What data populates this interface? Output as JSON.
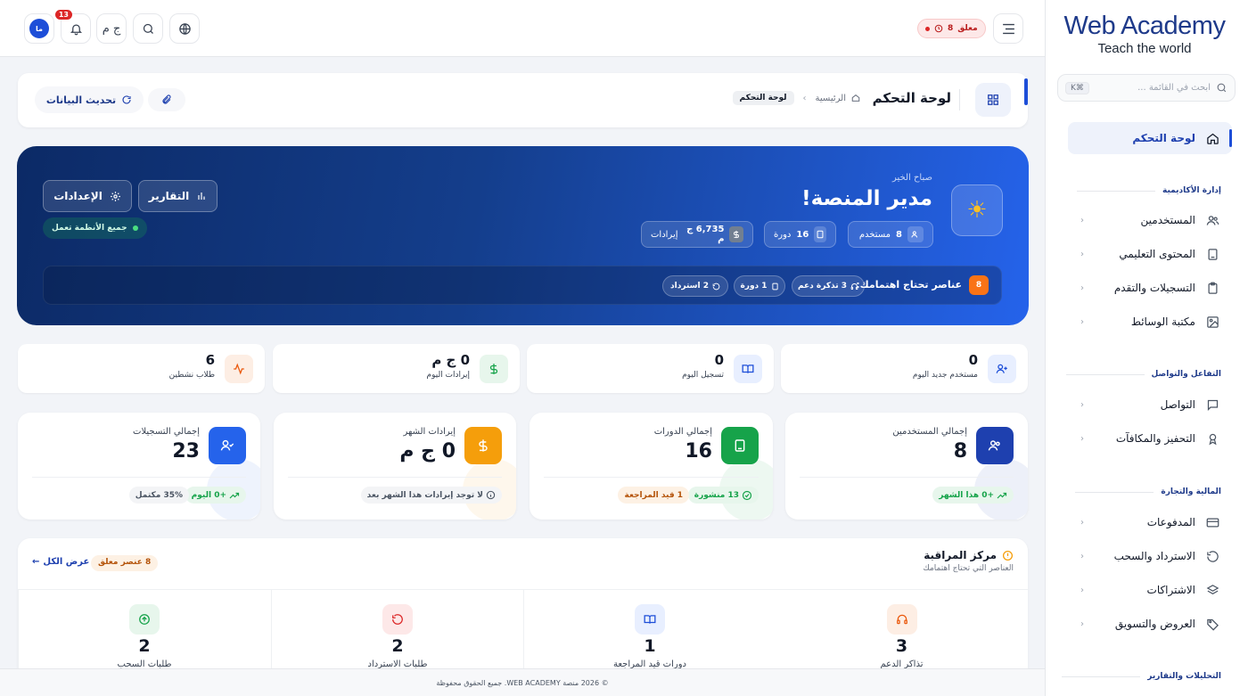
{
  "brand": {
    "name": "Web Academy",
    "tagline": "Teach the world"
  },
  "sidebar": {
    "search_placeholder": "ابحث في القائمة ...",
    "shortcut": "⌘K",
    "active": {
      "label": "لوحة التحكم",
      "icon": "home-icon"
    },
    "sections": [
      {
        "title": "إدارة الأكاديمية",
        "items": [
          {
            "label": "المستخدمين",
            "icon": "users-icon"
          },
          {
            "label": "المحتوى التعليمي",
            "icon": "book-icon"
          },
          {
            "label": "التسجيلات والتقدم",
            "icon": "clipboard-icon"
          },
          {
            "label": "مكتبة الوسائط",
            "icon": "image-icon"
          }
        ]
      },
      {
        "title": "التفاعل والتواصل",
        "items": [
          {
            "label": "التواصل",
            "icon": "chat-icon"
          },
          {
            "label": "التحفيز والمكافآت",
            "icon": "award-icon"
          }
        ]
      },
      {
        "title": "المالية والتجارة",
        "items": [
          {
            "label": "المدفوعات",
            "icon": "card-icon"
          },
          {
            "label": "الاسترداد والسحب",
            "icon": "refund-icon"
          },
          {
            "label": "الاشتراكات",
            "icon": "layers-icon"
          },
          {
            "label": "العروض والتسويق",
            "icon": "tag-icon"
          }
        ]
      },
      {
        "title": "التحليلات والتقارير",
        "items": []
      }
    ]
  },
  "topbar": {
    "avatar_initials": "ما",
    "notifications_count": "13",
    "currency_label": "ج م",
    "pending": {
      "count": "8",
      "label": "معلق"
    }
  },
  "header": {
    "title": "لوحة التحكم",
    "breadcrumb_home": "الرئيسية",
    "breadcrumb_current": "لوحة التحكم",
    "refresh_label": "تحديث البيانات"
  },
  "hero": {
    "greeting": "صباح الخير",
    "name": "مدير المنصة!",
    "chips": [
      {
        "value": "8",
        "label": "مستخدم",
        "icon": "users-icon"
      },
      {
        "value": "16",
        "label": "دورة",
        "icon": "book-icon"
      },
      {
        "value": "6,735 ج م",
        "label": "إيرادات",
        "icon": "dollar-icon"
      }
    ],
    "reports_label": "التقارير",
    "settings_label": "الإعدادات",
    "status_label": "جميع الأنظمة تعمل",
    "attention": {
      "count": "8",
      "label": "عناصر تحتاج اهتمامك:",
      "chips": [
        {
          "text": "3 تذكرة دعم",
          "icon": "headphones-icon"
        },
        {
          "text": "1 دورة",
          "icon": "book-icon"
        },
        {
          "text": "2 استرداد",
          "icon": "refund-icon"
        }
      ]
    }
  },
  "today": [
    {
      "value": "0",
      "label": "مستخدم جديد اليوم",
      "icon": "user-plus-icon",
      "color": "#1d4ed8",
      "bg": "#e8efff"
    },
    {
      "value": "0",
      "label": "تسجيل اليوم",
      "icon": "book-icon",
      "color": "#1d4ed8",
      "bg": "#e8efff"
    },
    {
      "value": "0 ج م",
      "label": "إيرادات اليوم",
      "icon": "dollar-icon",
      "color": "#16a34a",
      "bg": "#e7f6ec"
    },
    {
      "value": "6",
      "label": "طلاب نشطين",
      "icon": "activity-icon",
      "color": "#ea580c",
      "bg": "#fdeee4"
    }
  ],
  "totals": [
    {
      "label": "إجمالي المستخدمين",
      "value": "8",
      "icon": "users-icon",
      "color": "#1e40af",
      "pills": [
        {
          "text": "+0 هذا الشهر",
          "fg": "#16a34a",
          "bg": "#e7f6ec"
        }
      ]
    },
    {
      "label": "إجمالي الدورات",
      "value": "16",
      "icon": "book-icon",
      "color": "#16a34a",
      "pills": [
        {
          "text": "13 منشورة",
          "fg": "#16a34a",
          "bg": "#e7f6ec"
        },
        {
          "text": "1 قيد المراجعة",
          "fg": "#b45309",
          "bg": "#fdf1e4"
        }
      ]
    },
    {
      "label": "إيرادات الشهر",
      "value": "0 ج م",
      "icon": "dollar-icon",
      "color": "#f59e0b",
      "pills": [
        {
          "text": "لا توجد إيرادات هذا الشهر بعد",
          "fg": "#4b5563",
          "bg": "#f3f4f6"
        }
      ]
    },
    {
      "label": "إجمالي التسجيلات",
      "value": "23",
      "icon": "user-check-icon",
      "color": "#2563eb",
      "pills": [
        {
          "text": "+0 اليوم",
          "fg": "#16a34a",
          "bg": "#e7f6ec"
        },
        {
          "text": "35% مكتمل",
          "fg": "#4b5563",
          "bg": "#f3f4f6"
        }
      ]
    }
  ],
  "monitor": {
    "title": "مركز المراقبة",
    "subtitle": "العناصر التي تحتاج اهتمامك",
    "pending_badge": "8 عنصر معلق",
    "view_all": "عرض الكل",
    "items": [
      {
        "value": "3",
        "label": "تذاكر الدعم",
        "icon": "headphones-icon",
        "color": "#ea580c",
        "bg": "#fdeee4"
      },
      {
        "value": "1",
        "label": "دورات قيد المراجعة",
        "icon": "book-icon",
        "color": "#1d4ed8",
        "bg": "#e8efff"
      },
      {
        "value": "2",
        "label": "طلبات الاسترداد",
        "icon": "refund-icon",
        "color": "#dc2626",
        "bg": "#fde8e8"
      },
      {
        "value": "2",
        "label": "طلبات السحب",
        "icon": "arrow-circle-icon",
        "color": "#16a34a",
        "bg": "#e7f6ec"
      }
    ]
  },
  "footer": {
    "text": "© 2026 منصة WEB ACADEMY. جميع الحقوق محفوظة"
  }
}
